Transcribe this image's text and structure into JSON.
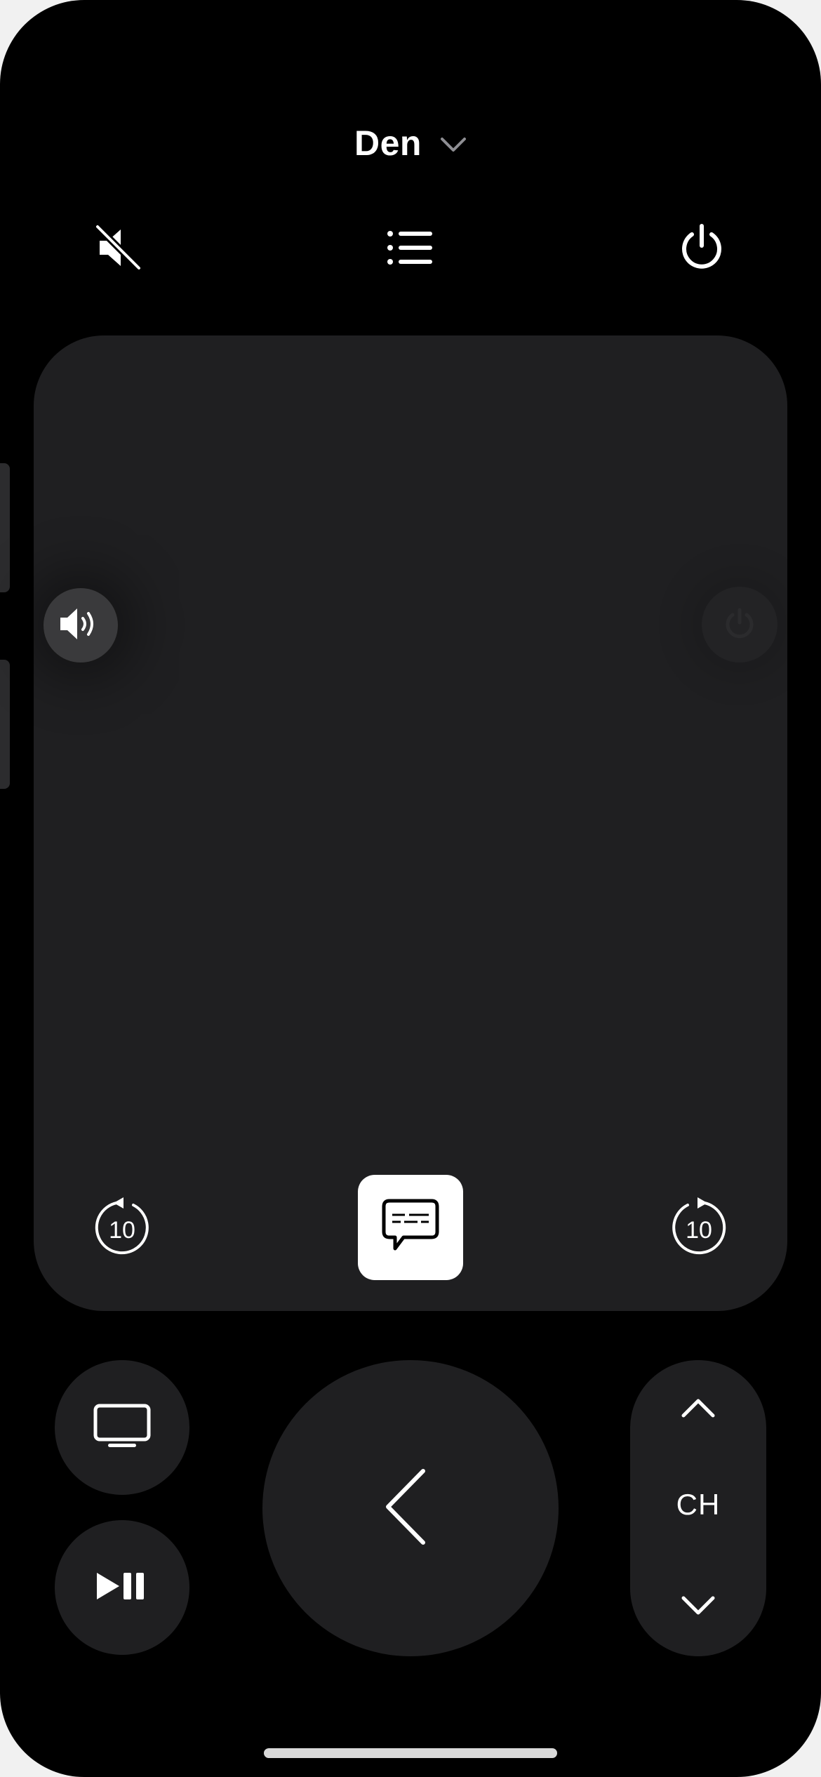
{
  "header": {
    "device_name": "Den"
  },
  "toolbar": {
    "mute_icon": "speaker-slash-icon",
    "guide_icon": "list-icon",
    "power_icon": "power-icon"
  },
  "touchpad": {
    "volume_icon": "speaker-wave-icon",
    "skip_back_label": "10",
    "skip_forward_label": "10",
    "captions_icon": "captions-bubble-icon"
  },
  "controls": {
    "tv_icon": "tv-icon",
    "play_pause_icon": "play-pause-icon",
    "back_icon": "chevron-left-icon",
    "channel_label": "CH",
    "channel_up_icon": "chevron-up-icon",
    "channel_down_icon": "chevron-down-icon"
  },
  "colors": {
    "background": "#000000",
    "panel": "#1f1f21",
    "foreground": "#ffffff"
  }
}
